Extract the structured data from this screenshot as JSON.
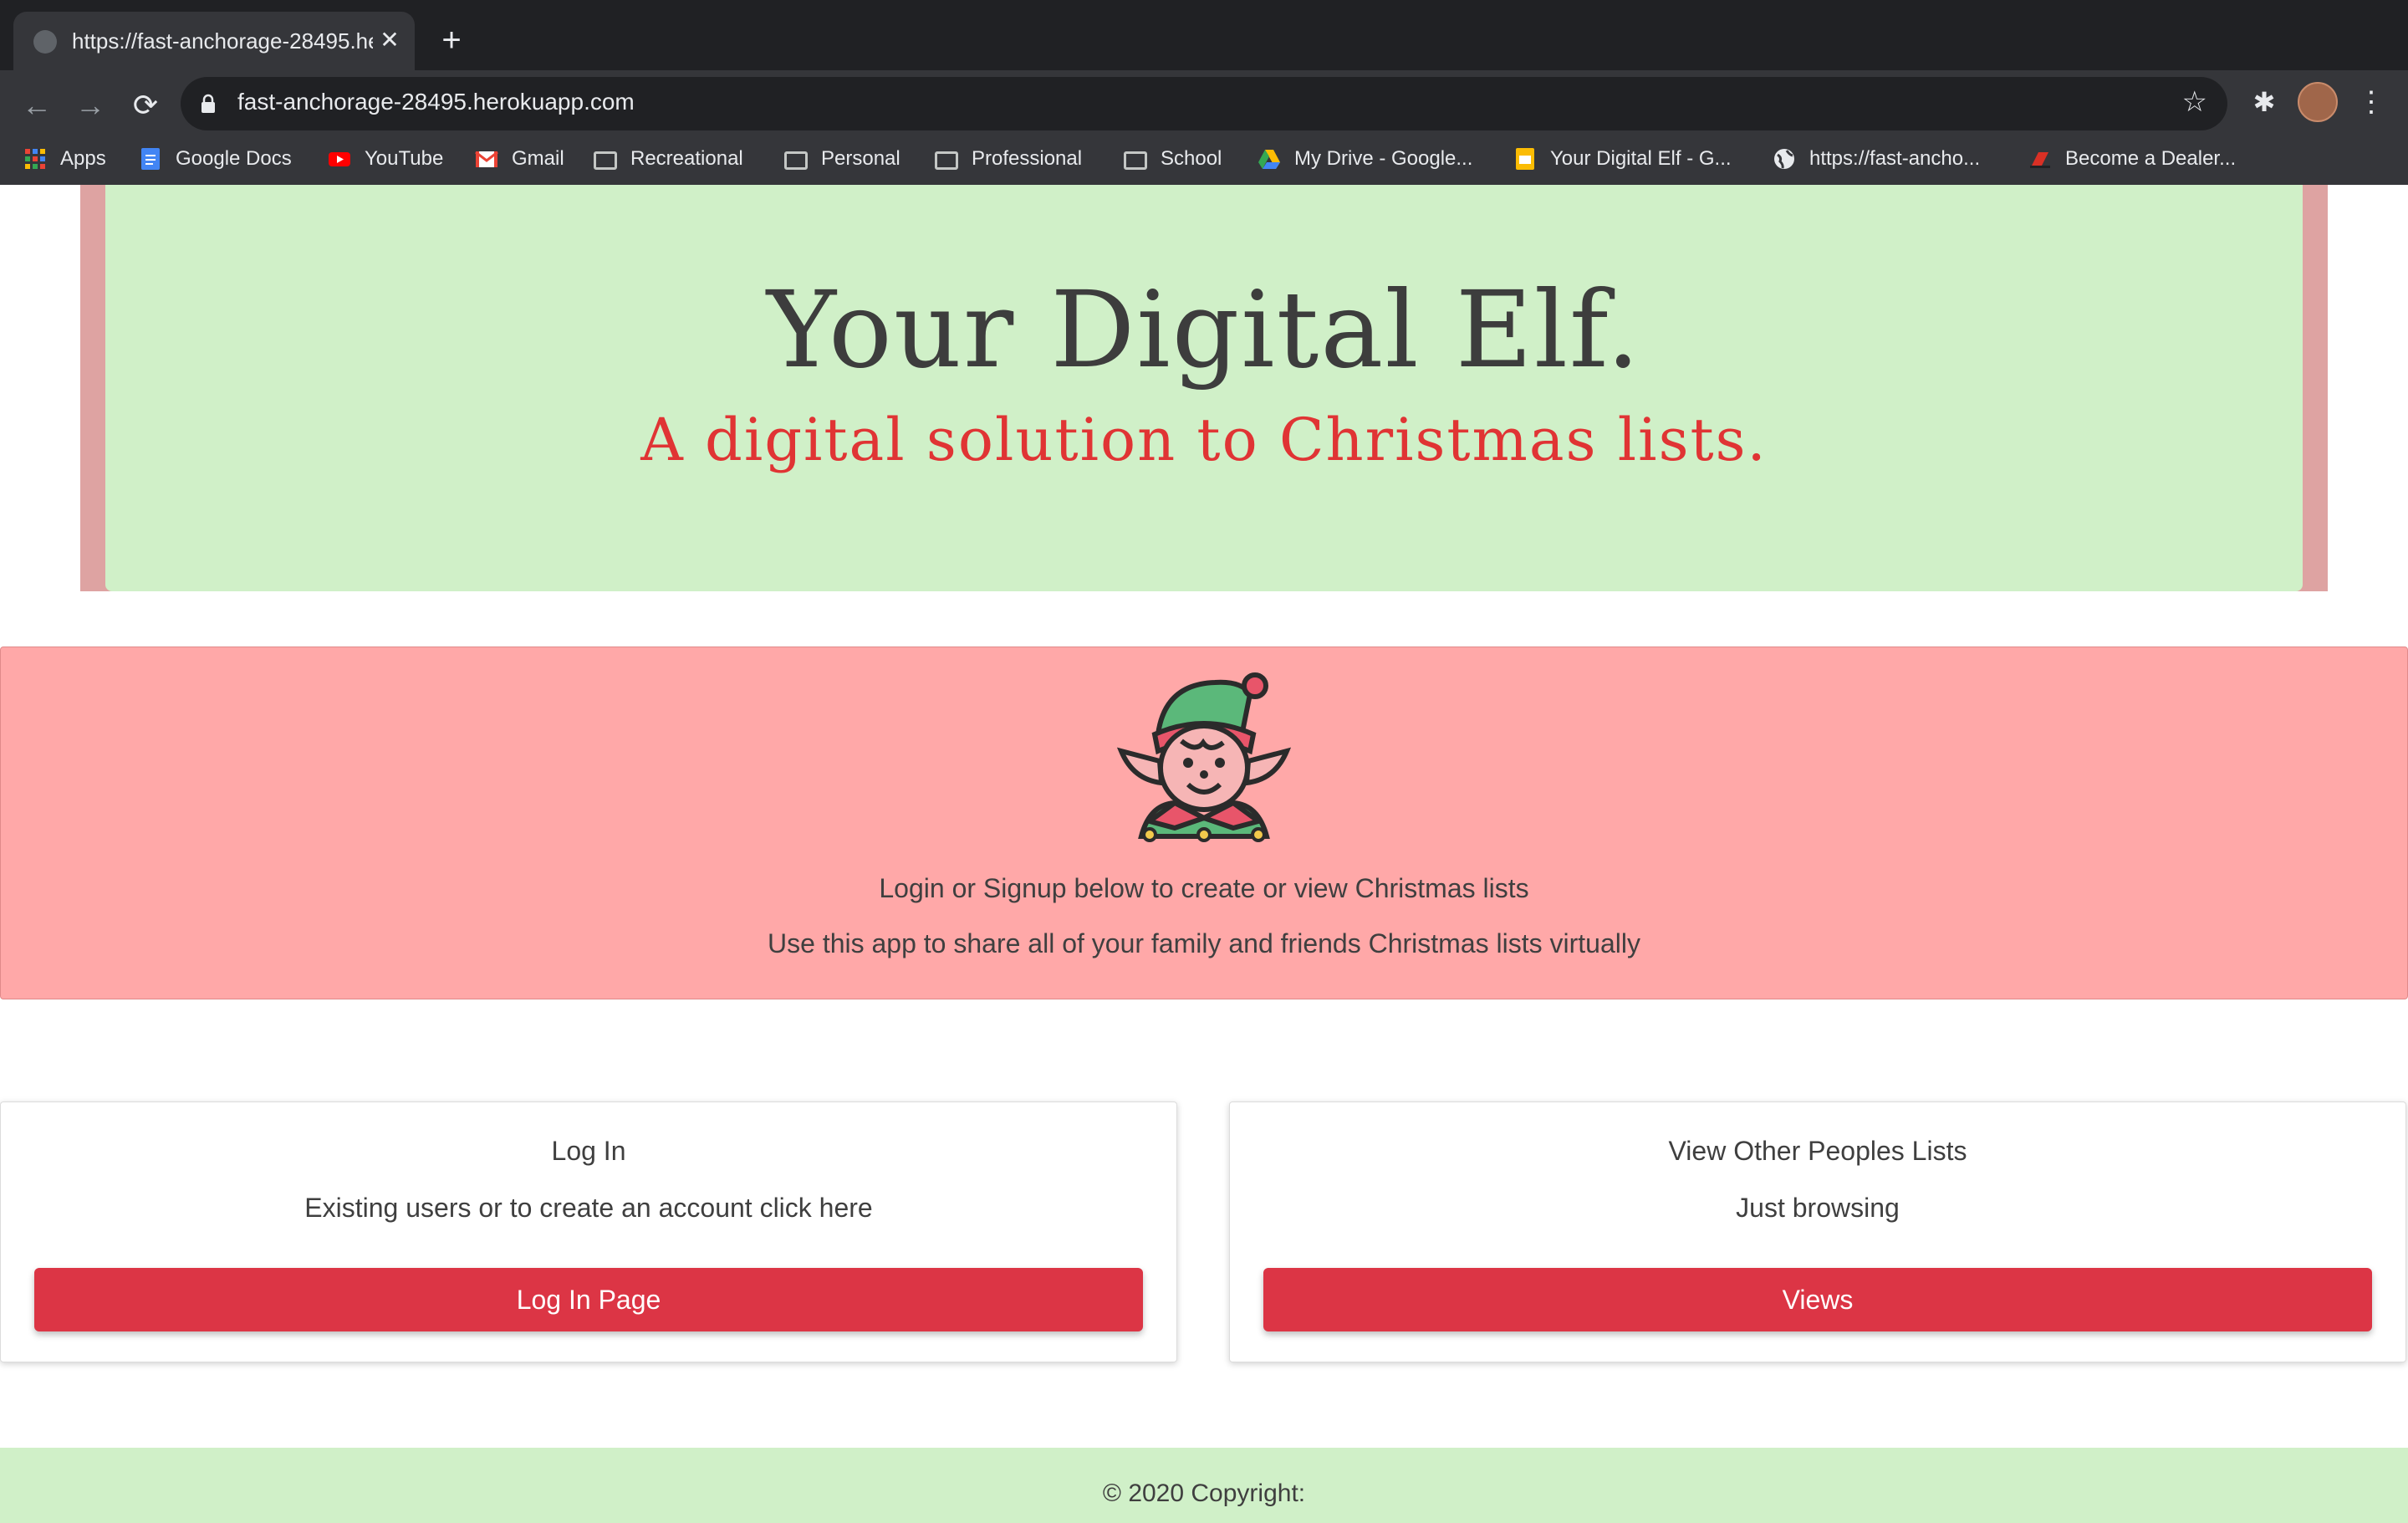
{
  "browser": {
    "tab_title": "https://fast-anchorage-28495.herokuapp.com",
    "url": "fast-anchorage-28495.herokuapp.com",
    "bookmarks": [
      {
        "label": "Apps",
        "icon": "apps-grid-icon"
      },
      {
        "label": "Google Docs",
        "icon": "google-docs-icon"
      },
      {
        "label": "YouTube",
        "icon": "youtube-icon"
      },
      {
        "label": "Gmail",
        "icon": "gmail-icon"
      },
      {
        "label": "Recreational",
        "icon": "folder-icon"
      },
      {
        "label": "Personal",
        "icon": "folder-icon"
      },
      {
        "label": "Professional",
        "icon": "folder-icon"
      },
      {
        "label": "School",
        "icon": "folder-icon"
      },
      {
        "label": "My Drive - Google...",
        "icon": "google-drive-icon"
      },
      {
        "label": "Your Digital Elf - G...",
        "icon": "google-slides-icon"
      },
      {
        "label": "https://fast-ancho...",
        "icon": "globe-icon"
      },
      {
        "label": "Become a Dealer...",
        "icon": "dealer-logo-icon"
      }
    ]
  },
  "hero": {
    "title": "Your Digital Elf.",
    "subtitle": "A digital solution to Christmas lists."
  },
  "banner": {
    "line1": "Login or Signup below to create or view Christmas lists",
    "line2": "Use this app to share all of your family and friends Christmas lists virtually"
  },
  "cards": {
    "login": {
      "title": "Log In",
      "text": "Existing users or to create an account click here",
      "button": "Log In Page"
    },
    "views": {
      "title": "View Other Peoples Lists",
      "text": "Just browsing",
      "button": "Views"
    }
  },
  "footer": {
    "text": "© 2020 Copyright:"
  },
  "colors": {
    "hero_bg": "#d0f0c8",
    "hero_border": "#dea3a2",
    "subtitle": "#e03434",
    "banner_bg": "#ffa8a8",
    "button": "#dc3545"
  }
}
